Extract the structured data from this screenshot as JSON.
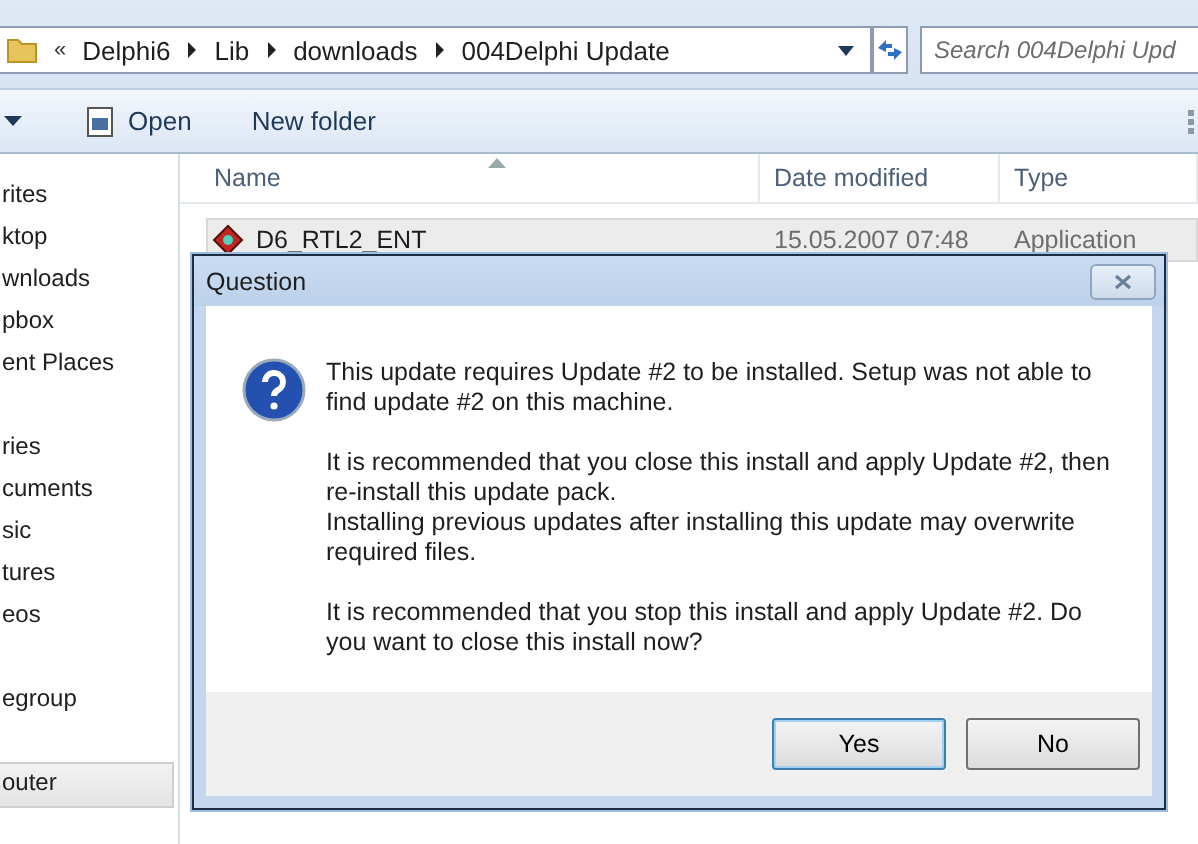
{
  "address_bar": {
    "overflow": "«",
    "crumbs": [
      "Delphi6",
      "Lib",
      "downloads",
      "004Delphi Update"
    ]
  },
  "search": {
    "placeholder": "Search 004Delphi Upd"
  },
  "toolbar": {
    "items": [
      "Open",
      "New folder"
    ]
  },
  "sidebar": {
    "groups": [
      {
        "items": [
          {
            "label": "rites",
            "selected": false
          },
          {
            "label": "ktop",
            "selected": false
          },
          {
            "label": "wnloads",
            "selected": false
          },
          {
            "label": "pbox",
            "selected": false
          },
          {
            "label": "ent Places",
            "selected": false
          }
        ]
      },
      {
        "items": [
          {
            "label": "ries",
            "selected": false
          },
          {
            "label": "cuments",
            "selected": false
          },
          {
            "label": "sic",
            "selected": false
          },
          {
            "label": "tures",
            "selected": false
          },
          {
            "label": "eos",
            "selected": false
          }
        ]
      },
      {
        "items": [
          {
            "label": "egroup",
            "selected": false
          }
        ]
      },
      {
        "items": [
          {
            "label": "outer",
            "selected": true
          }
        ]
      }
    ]
  },
  "table": {
    "columns": [
      "Name",
      "Date modified",
      "Type"
    ],
    "rows": [
      {
        "name": "D6_RTL2_ENT",
        "date": "15.05.2007 07:48",
        "type": "Application",
        "selected": true
      }
    ]
  },
  "dialog": {
    "title": "Question",
    "paragraphs": [
      {
        "lines": [
          "This update requires Update #2 to be installed. Setup was not able to find update #2 on this machine."
        ]
      },
      {
        "lines": [
          "It is recommended that you close this install and apply Update #2, then re-install this update pack.",
          "Installing previous updates after installing this update may overwrite required files."
        ]
      },
      {
        "lines": [
          "It is recommended that you stop this install and apply Update #2. Do you want to close this install now?"
        ]
      }
    ],
    "buttons": [
      {
        "label": "Yes",
        "default": true
      },
      {
        "label": "No",
        "default": false
      }
    ]
  }
}
